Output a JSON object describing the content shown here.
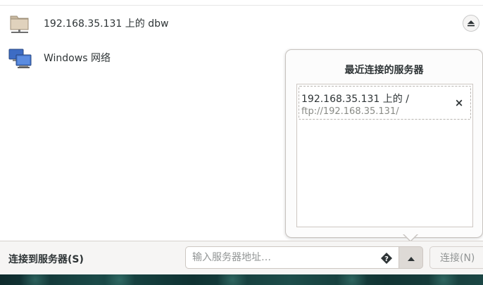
{
  "places": [
    {
      "label": "192.168.35.131 上的 dbw",
      "icon": "folder-network-icon",
      "action_icon": "eject-icon"
    },
    {
      "label": "Windows 网络",
      "icon": "network-computers-icon"
    }
  ],
  "popover": {
    "title": "最近连接的服务器",
    "servers": [
      {
        "name": "192.168.35.131 上的 /",
        "uri": "ftp://192.168.35.131/"
      }
    ],
    "remove_symbol": "×"
  },
  "connect_bar": {
    "label": "连接到服务器(S)",
    "placeholder": "输入服务器地址…",
    "help_icon": "question-diamond-icon",
    "dropdown_icon": "triangle-up-icon",
    "connect_button": "连接(N)"
  },
  "colors": {
    "folder": "#d8c9b4",
    "monitor_blue": "#3d6cc4",
    "wallpaper": "#1a4a48"
  }
}
